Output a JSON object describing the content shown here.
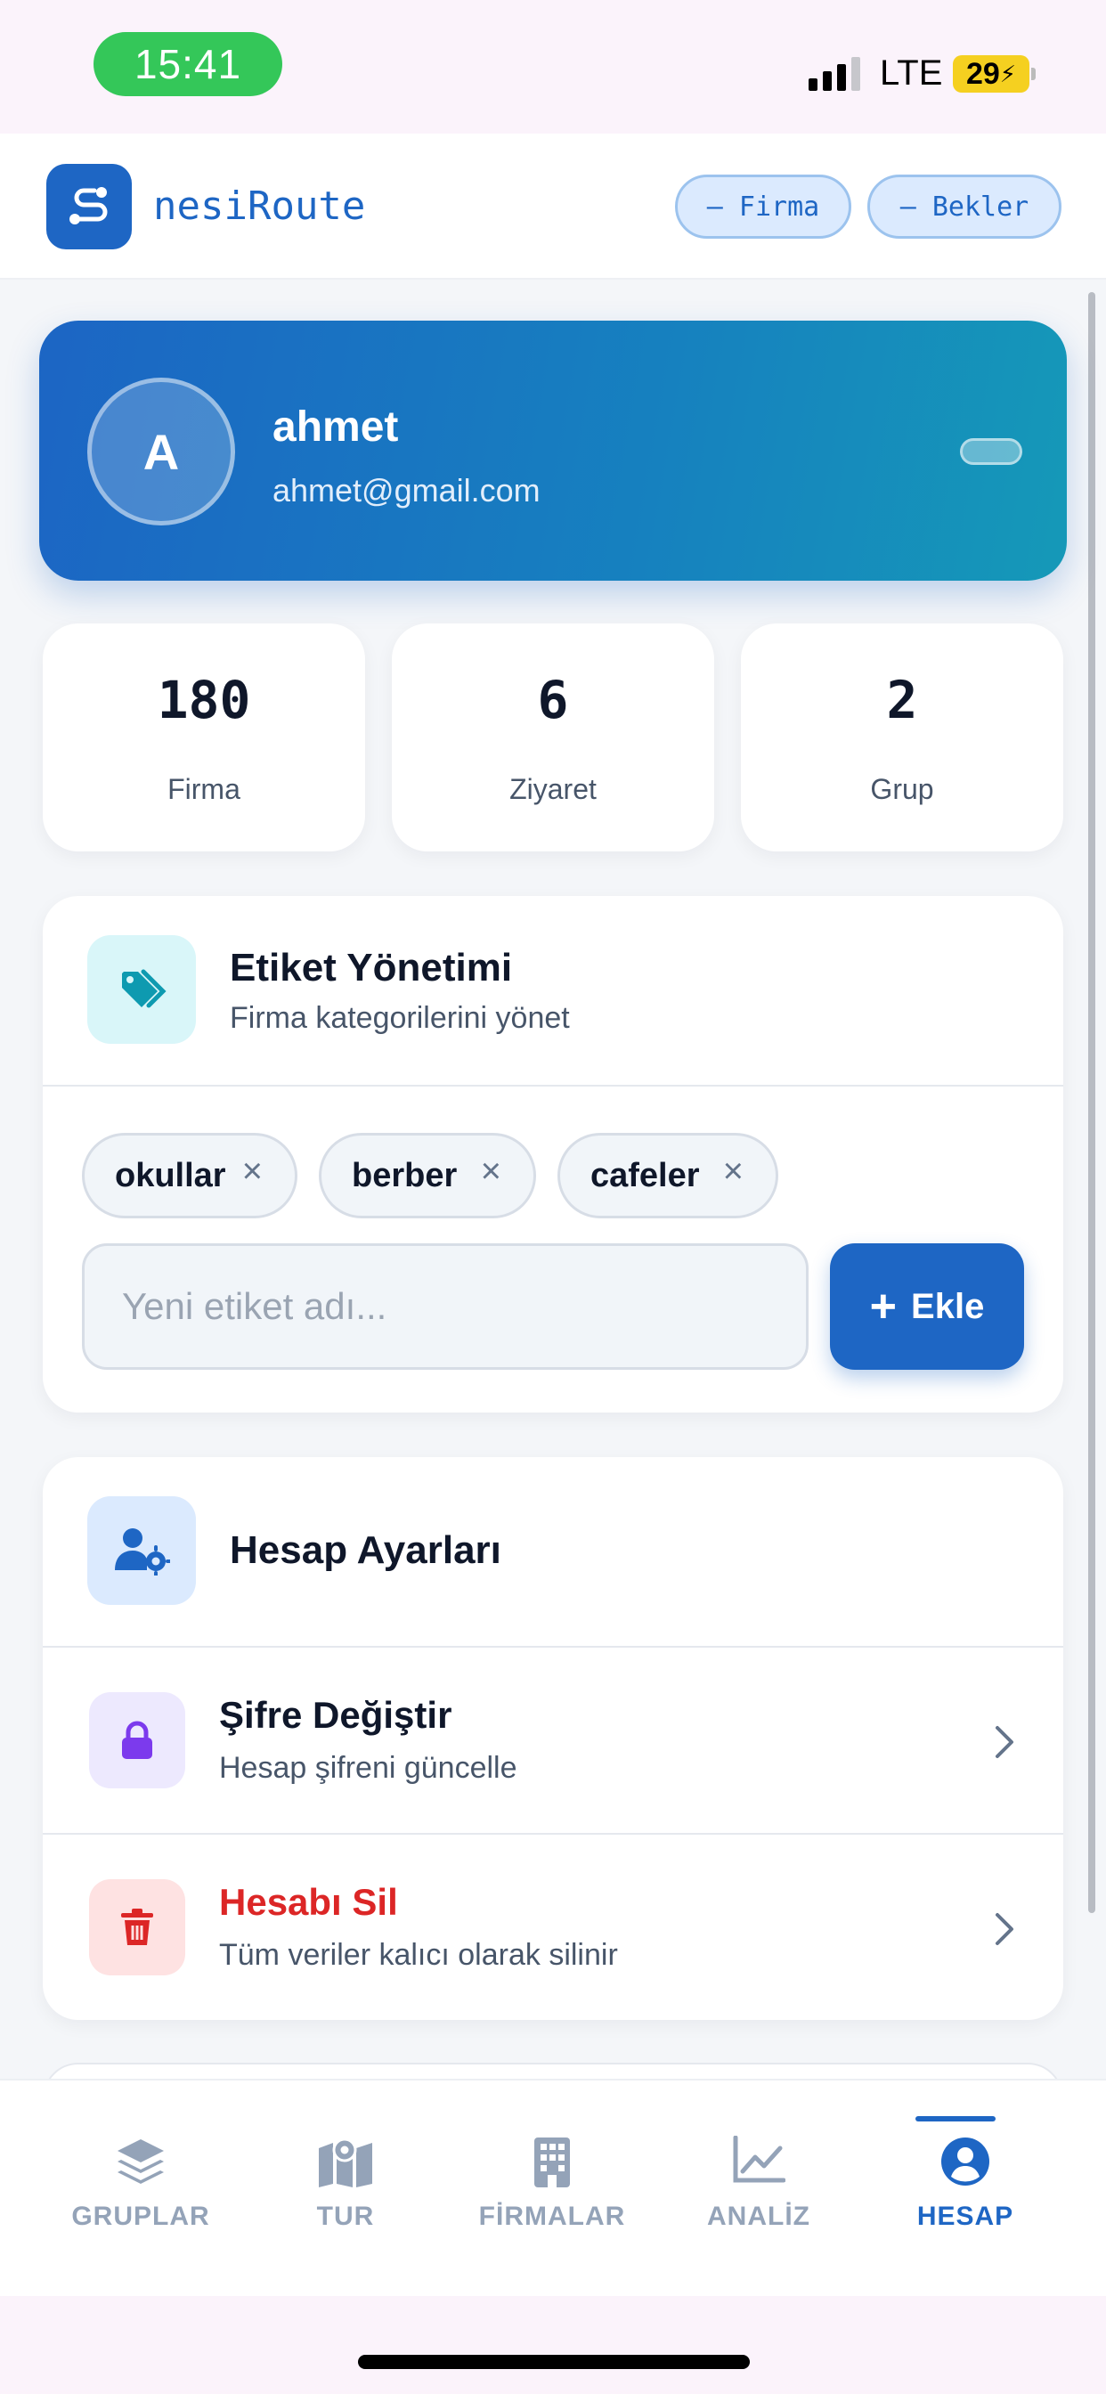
{
  "status_bar": {
    "time": "15:41",
    "network": "LTE",
    "battery": "29"
  },
  "header": {
    "app_name": "nesiRoute",
    "pill_firma": "– Firma",
    "pill_bekler": "– Bekler"
  },
  "profile": {
    "initial": "A",
    "name": "ahmet",
    "email": "ahmet@gmail.com"
  },
  "stats": [
    {
      "value": "180",
      "label": "Firma"
    },
    {
      "value": "6",
      "label": "Ziyaret"
    },
    {
      "value": "2",
      "label": "Grup"
    }
  ],
  "tags": {
    "title": "Etiket Yönetimi",
    "subtitle": "Firma kategorilerini yönet",
    "items": [
      {
        "label": "okullar",
        "remove": "×"
      },
      {
        "label": "berber",
        "remove": "×"
      },
      {
        "label": "cafeler",
        "remove": "×"
      }
    ],
    "input_placeholder": "Yeni etiket adı...",
    "add_label": "Ekle",
    "add_symbol": "+"
  },
  "account": {
    "title": "Hesap Ayarları",
    "rows": [
      {
        "title": "Şifre Değiştir",
        "subtitle": "Hesap şifreni güncelle"
      },
      {
        "title": "Hesabı Sil",
        "subtitle": "Tüm veriler kalıcı olarak silinir"
      }
    ]
  },
  "nav": [
    {
      "label": "GRUPLAR",
      "icon": "layers-icon"
    },
    {
      "label": "TUR",
      "icon": "map-pin-icon"
    },
    {
      "label": "FİRMALAR",
      "icon": "building-icon"
    },
    {
      "label": "ANALİZ",
      "icon": "chart-line-icon"
    },
    {
      "label": "HESAP",
      "icon": "user-circle-icon",
      "active": true
    }
  ],
  "colors": {
    "primary": "#1e66c4",
    "danger": "#dc2626",
    "purple": "#7c3aed",
    "teal": "#0e9ab0"
  }
}
